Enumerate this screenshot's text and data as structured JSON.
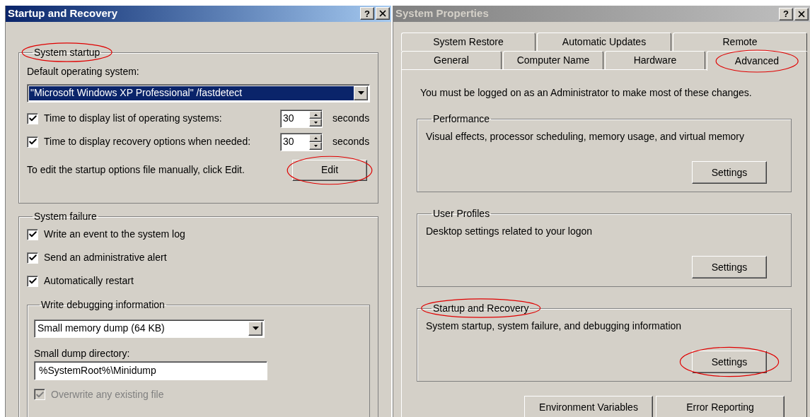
{
  "startup_window": {
    "title": "Startup and Recovery",
    "active": true,
    "help": "?",
    "system_startup": {
      "title": "System startup",
      "circled": true,
      "default_os_label": "Default operating system:",
      "default_os_value": "\"Microsoft Windows XP Professional\" /fastdetect",
      "timers": [
        {
          "label": "Time to display list of operating systems:",
          "checked": true,
          "value": "30",
          "unit": "seconds"
        },
        {
          "label": "Time to display recovery options when needed:",
          "checked": true,
          "value": "30",
          "unit": "seconds"
        }
      ],
      "edit_hint": "To edit the startup options file manually, click Edit.",
      "edit_button": {
        "label": "Edit",
        "circled": true
      }
    },
    "system_failure": {
      "title": "System failure",
      "options": [
        {
          "label": "Write an event to the system log",
          "checked": true,
          "disabled": false
        },
        {
          "label": "Send an administrative alert",
          "checked": true,
          "disabled": false
        },
        {
          "label": "Automatically restart",
          "checked": true,
          "disabled": false
        }
      ],
      "debugging": {
        "title": "Write debugging information",
        "dump_type": "Small memory dump (64 KB)",
        "dir_label": "Small dump directory:",
        "dir_value": "%SystemRoot%\\Minidump",
        "overwrite": {
          "label": "Overwrite any existing file",
          "checked": true,
          "disabled": true
        }
      }
    }
  },
  "properties_window": {
    "title": "System Properties",
    "active": false,
    "help": "?",
    "tab_rows": [
      [
        {
          "label": "System Restore",
          "selected": false,
          "circled": false
        },
        {
          "label": "Automatic Updates",
          "selected": false,
          "circled": false
        },
        {
          "label": "Remote",
          "selected": false,
          "circled": false
        }
      ],
      [
        {
          "label": "General",
          "selected": false,
          "circled": false
        },
        {
          "label": "Computer Name",
          "selected": false,
          "circled": false
        },
        {
          "label": "Hardware",
          "selected": false,
          "circled": false
        },
        {
          "label": "Advanced",
          "selected": true,
          "circled": true
        }
      ]
    ],
    "note": "You must be logged on as an Administrator to make most of these changes.",
    "groups": [
      {
        "title": "Performance",
        "title_circled": false,
        "description": "Visual effects, processor scheduling, memory usage, and virtual memory",
        "button": "Settings",
        "button_circled": false
      },
      {
        "title": "User Profiles",
        "title_circled": false,
        "description": "Desktop settings related to your logon",
        "button": "Settings",
        "button_circled": false
      },
      {
        "title": "Startup and Recovery",
        "title_circled": true,
        "description": "System startup, system failure, and debugging information",
        "button": "Settings",
        "button_circled": true
      }
    ],
    "buttons": [
      "Environment Variables",
      "Error Reporting"
    ]
  }
}
